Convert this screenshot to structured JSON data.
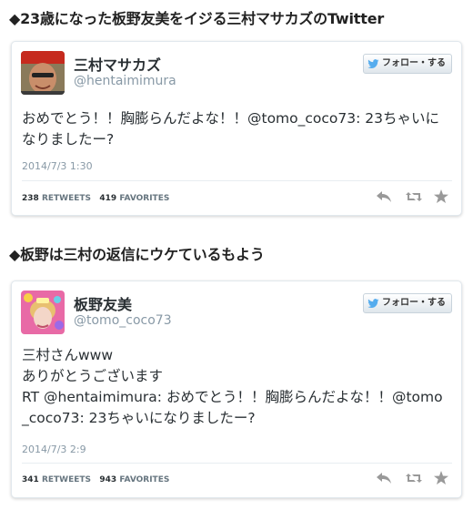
{
  "sections": [
    {
      "heading": "◆23歳になった板野友美をイジる三村マサカズのTwitter",
      "tweet": {
        "name": "三村マサカズ",
        "handle": "@hentaimimura",
        "follow_label": "フォロー・する",
        "text": "おめでとう！！胸膨らんだよな！！@tomo_coco73: 23ちゃいに\nなりましたー?",
        "timestamp": "2014/7/3 1:30",
        "retweets": "238",
        "retweets_label": "RETWEETS",
        "favorites": "419",
        "favorites_label": "FAVORITES"
      }
    },
    {
      "heading": "◆板野は三村の返信にウケているもよう",
      "tweet": {
        "name": "板野友美",
        "handle": "@tomo_coco73",
        "follow_label": "フォロー・する",
        "text": "三村さんwww\nありがとうございます\nRT @hentaimimura: おめでとう！！胸膨らんだよな！！@tomo\n_coco73: 23ちゃいになりましたー?",
        "timestamp": "2014/7/3 2:9",
        "retweets": "341",
        "retweets_label": "RETWEETS",
        "favorites": "943",
        "favorites_label": "FAVORITES"
      }
    }
  ],
  "colors": {
    "twitter_blue": "#55acee",
    "muted": "#8899a6",
    "action_icon": "#999999"
  },
  "icons": [
    "twitter-bird-icon",
    "reply-icon",
    "retweet-icon",
    "favorite-star-icon"
  ]
}
